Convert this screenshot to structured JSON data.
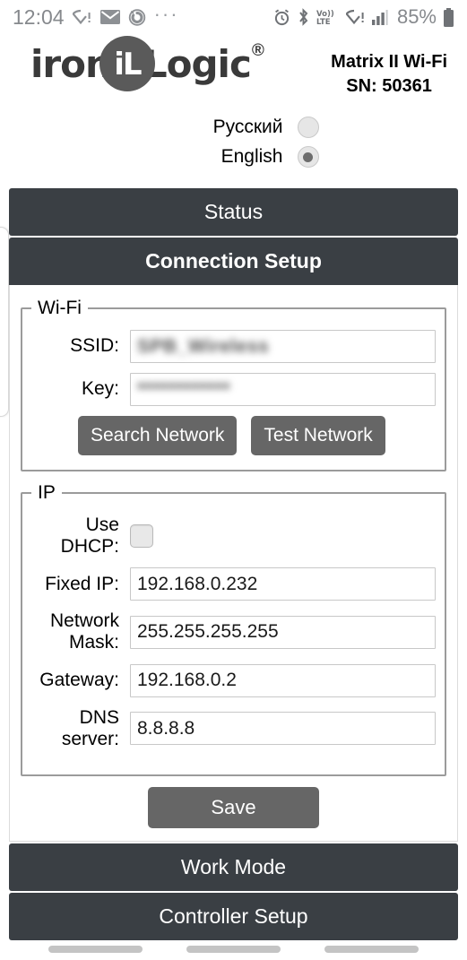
{
  "statusbar": {
    "time": "12:04",
    "left_icons": [
      "wifi-alert-icon",
      "mail-icon",
      "alarm-circle-icon",
      "more-dots-icon"
    ],
    "right_icons": [
      "alarm-icon",
      "bluetooth-icon",
      "volte-icon",
      "wifi-alert-icon",
      "signal-bars-icon"
    ],
    "battery_percent": "85%",
    "volte_label": "Vo))",
    "volte_sub": "LTE",
    "dots": "···"
  },
  "brand": {
    "text_left": "iron",
    "badge_text": "iL",
    "text_right": "Logic",
    "registered": "®"
  },
  "device": {
    "model": "Matrix II Wi-Fi",
    "serial": "SN: 50361"
  },
  "language": {
    "options": [
      {
        "label": "Русский",
        "selected": false
      },
      {
        "label": "English",
        "selected": true
      }
    ]
  },
  "sections": {
    "status": "Status",
    "connection_setup": "Connection Setup",
    "work_mode": "Work Mode",
    "controller_setup": "Controller Setup"
  },
  "wifi": {
    "legend": "Wi-Fi",
    "ssid_label": "SSID:",
    "ssid_value": "SPB_Wireless",
    "key_label": "Key:",
    "key_value": "************",
    "search_button": "Search Network",
    "test_button": "Test Network"
  },
  "ip": {
    "legend": "IP",
    "dhcp_label": "Use DHCP:",
    "dhcp_checked": false,
    "fields": [
      {
        "label": "Fixed IP:",
        "value": "192.168.0.232"
      },
      {
        "label": "Network Mask:",
        "value": "255.255.255.255"
      },
      {
        "label": "Gateway:",
        "value": "192.168.0.2"
      },
      {
        "label": "DNS server:",
        "value": "8.8.8.8"
      }
    ]
  },
  "save_button": "Save",
  "colors": {
    "section_bar": "#3a3f44",
    "button": "#666666",
    "accent_text": "#ffffff"
  }
}
